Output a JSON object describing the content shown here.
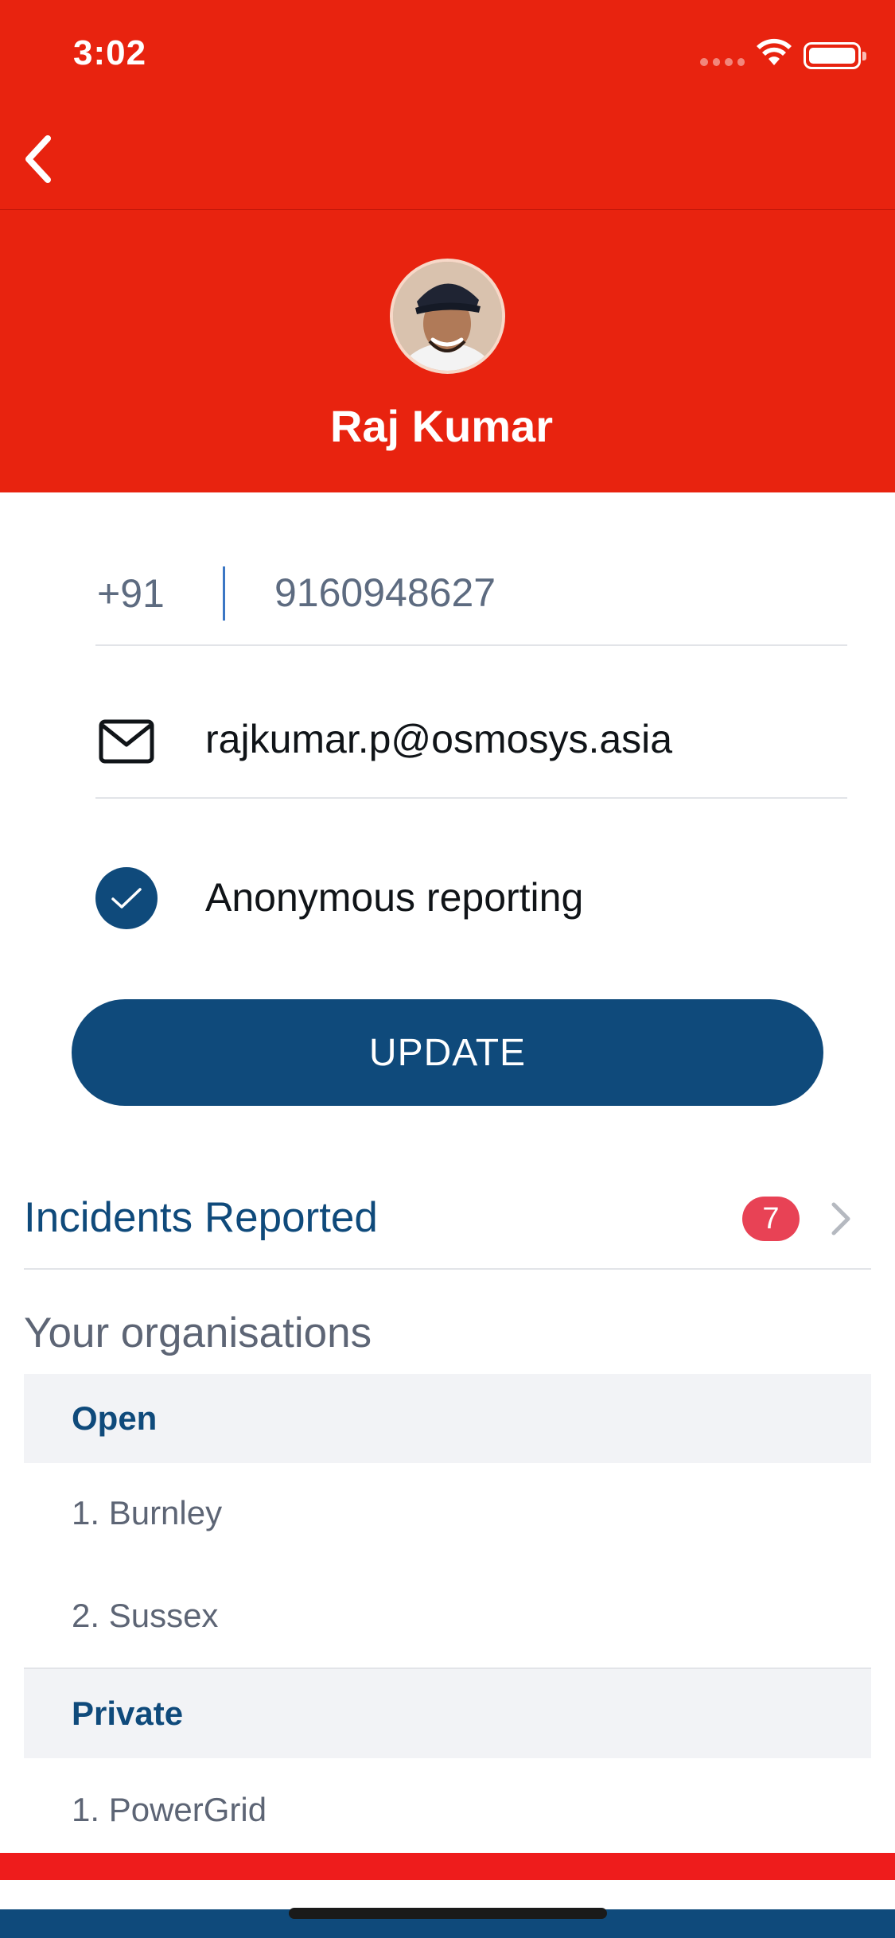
{
  "status_bar": {
    "time": "3:02"
  },
  "nav": {
    "back_icon": "chevron-left-icon"
  },
  "profile": {
    "name": "Raj Kumar",
    "avatar_icon": "avatar-photo"
  },
  "form": {
    "country_code": "+91",
    "phone_number": "9160948627",
    "email_icon": "mail-icon",
    "email": "rajkumar.p@osmosys.asia",
    "anonymous_label": "Anonymous reporting",
    "anonymous_checked": true,
    "update_label": "UPDATE"
  },
  "incidents": {
    "label": "Incidents Reported",
    "count": "7"
  },
  "organisations": {
    "title": "Your organisations",
    "sections": [
      {
        "name": "Open",
        "items": [
          "1. Burnley",
          "2. Sussex"
        ]
      },
      {
        "name": "Private",
        "items": [
          "1. PowerGrid"
        ]
      }
    ]
  },
  "colors": {
    "header_red": "#e8230f",
    "primary_blue": "#0f4a7b",
    "badge_red": "#e84255"
  }
}
